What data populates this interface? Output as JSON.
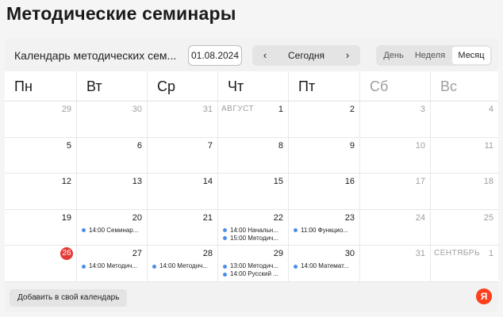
{
  "page": {
    "title": "Методические семинары"
  },
  "toolbar": {
    "calendar_name": "Календарь методических сем...",
    "date_value": "01.08.2024",
    "prev_glyph": "‹",
    "next_glyph": "›",
    "today_label": "Сегодня",
    "views": {
      "day": "День",
      "week": "Неделя",
      "month": "Месяц"
    },
    "active_view": "Месяц"
  },
  "weekdays": [
    "Пн",
    "Вт",
    "Ср",
    "Чт",
    "Пт",
    "Сб",
    "Вс"
  ],
  "weeks": [
    [
      {
        "d": "29",
        "muted": true
      },
      {
        "d": "30",
        "muted": true
      },
      {
        "d": "31",
        "muted": true
      },
      {
        "d": "1",
        "month": "АВГУСТ"
      },
      {
        "d": "2"
      },
      {
        "d": "3",
        "muted": true
      },
      {
        "d": "4",
        "muted": true
      }
    ],
    [
      {
        "d": "5"
      },
      {
        "d": "6"
      },
      {
        "d": "7"
      },
      {
        "d": "8"
      },
      {
        "d": "9"
      },
      {
        "d": "10",
        "muted": true
      },
      {
        "d": "11",
        "muted": true
      }
    ],
    [
      {
        "d": "12"
      },
      {
        "d": "13"
      },
      {
        "d": "14"
      },
      {
        "d": "15"
      },
      {
        "d": "16"
      },
      {
        "d": "17",
        "muted": true
      },
      {
        "d": "18",
        "muted": true
      }
    ],
    [
      {
        "d": "19"
      },
      {
        "d": "20",
        "events": [
          "14:00 Семинар..."
        ]
      },
      {
        "d": "21"
      },
      {
        "d": "22",
        "events": [
          "14:00 Начальн...",
          "15:00 Методич..."
        ]
      },
      {
        "d": "23",
        "events": [
          "11:00 Функцио..."
        ]
      },
      {
        "d": "24",
        "muted": true
      },
      {
        "d": "25",
        "muted": true
      }
    ],
    [
      {
        "d": "26",
        "today": true
      },
      {
        "d": "27",
        "events": [
          "14:00 Методич..."
        ]
      },
      {
        "d": "28",
        "events": [
          "14:00 Методич..."
        ]
      },
      {
        "d": "29",
        "events": [
          "13:00 Методич...",
          "14:00 Русский ..."
        ]
      },
      {
        "d": "30",
        "events": [
          "14:00 Математ..."
        ]
      },
      {
        "d": "31",
        "muted": true
      },
      {
        "d": "1",
        "muted": true,
        "month": "СЕНТЯБРЬ"
      }
    ]
  ],
  "footer": {
    "add_label": "Добавить в свой календарь",
    "logo_glyph": "Я"
  },
  "colors": {
    "today": "#e53935",
    "event_dot": "#4a8fe7",
    "logo": "#fc3f1d"
  }
}
